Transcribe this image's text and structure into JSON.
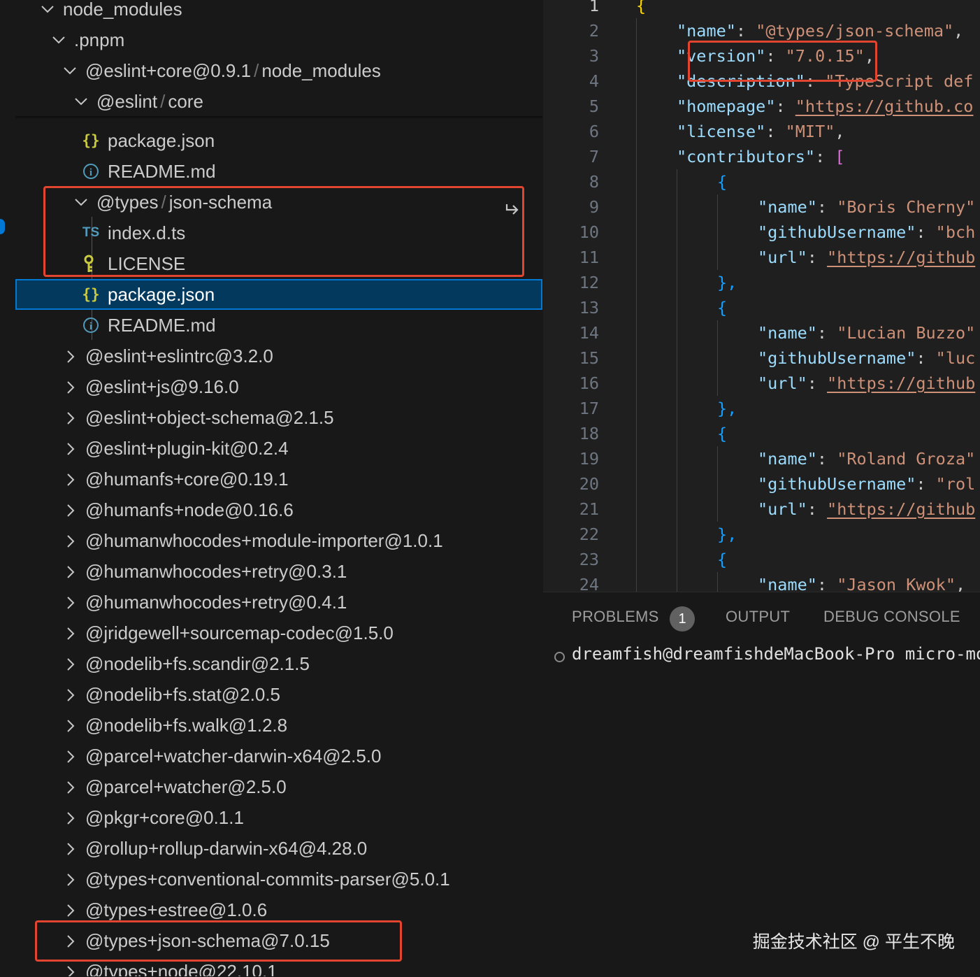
{
  "explorer": {
    "node_modules": "node_modules",
    "pnpm": ".pnpm",
    "eslint_core_pkg": "@eslint+core@0.9.1",
    "eslint_core_pkg_sub": "node_modules",
    "eslint_scope": "@eslint",
    "eslint_core": "core",
    "file_package_json_1": "package.json",
    "file_readme_1": "README.md",
    "types_scope": "@types",
    "json_schema": "json-schema",
    "file_index_dts": "index.d.ts",
    "file_license": "LICENSE",
    "file_package_json_2": "package.json",
    "file_readme_2": "README.md",
    "folders": [
      "@eslint+eslintrc@3.2.0",
      "@eslint+js@9.16.0",
      "@eslint+object-schema@2.1.5",
      "@eslint+plugin-kit@0.2.4",
      "@humanfs+core@0.19.1",
      "@humanfs+node@0.16.6",
      "@humanwhocodes+module-importer@1.0.1",
      "@humanwhocodes+retry@0.3.1",
      "@humanwhocodes+retry@0.4.1",
      "@jridgewell+sourcemap-codec@1.5.0",
      "@nodelib+fs.scandir@2.1.5",
      "@nodelib+fs.stat@2.0.5",
      "@nodelib+fs.walk@1.2.8",
      "@parcel+watcher-darwin-x64@2.5.0",
      "@parcel+watcher@2.5.0",
      "@pkgr+core@0.1.1",
      "@rollup+rollup-darwin-x64@4.28.0",
      "@types+conventional-commits-parser@5.0.1",
      "@types+estree@1.0.6",
      "@types+json-schema@7.0.15",
      "@types+node@22.10.1"
    ],
    "icons": {
      "json": "{}",
      "ts": "TS",
      "info": "i"
    }
  },
  "editor": {
    "line_numbers": [
      "1",
      "2",
      "3",
      "4",
      "5",
      "6",
      "7",
      "8",
      "9",
      "10",
      "11",
      "12",
      "13",
      "14",
      "15",
      "16",
      "17",
      "18",
      "19",
      "20",
      "21",
      "22",
      "23",
      "24"
    ],
    "l1": "{",
    "l2k": "\"name\"",
    "l2v": "\"@types/json-schema\"",
    "l3k": "\"version\"",
    "l3v": "\"7.0.15\"",
    "l4k": "\"description\"",
    "l4v": "\"TypeScript def",
    "l5k": "\"homepage\"",
    "l5v": "\"https://github.co",
    "l6k": "\"license\"",
    "l6v": "\"MIT\"",
    "l7k": "\"contributors\"",
    "l7v": "[",
    "obrace": "{",
    "cbrace": "},",
    "k_name": "\"name\"",
    "k_gh": "\"githubUsername\"",
    "k_url": "\"url\"",
    "c1_name": "\"Boris Cherny\"",
    "c1_gh": "\"bch",
    "c1_url": "\"https://github",
    "c2_name": "\"Lucian Buzzo\"",
    "c2_gh": "\"luc",
    "c2_url": "\"https://github",
    "c3_name": "\"Roland Groza\"",
    "c3_gh": "\"rol",
    "c3_url": "\"https://github",
    "c4_name": "\"Jason Kwok\"",
    "colon": ": ",
    "comma": ","
  },
  "panel": {
    "tabs": [
      "PROBLEMS",
      "OUTPUT",
      "DEBUG CONSOLE"
    ],
    "problems_count": "1",
    "terminal_line": "dreamfish@dreamfishdeMacBook-Pro micro-mor"
  },
  "watermark": "掘金技术社区 @ 平生不晚"
}
